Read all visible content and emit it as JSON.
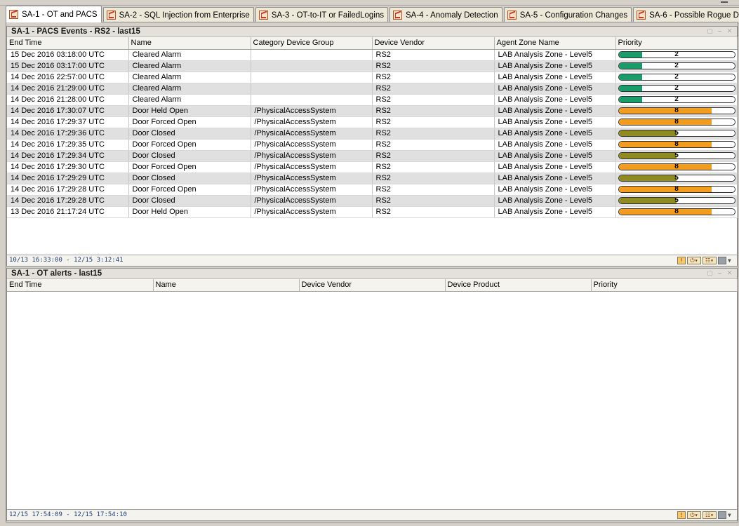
{
  "tabs": [
    {
      "label": "SA-1 - OT and PACS",
      "active": true
    },
    {
      "label": "SA-2 - SQL Injection from Enterprise",
      "active": false
    },
    {
      "label": "SA-3 - OT-to-IT or FailedLogins",
      "active": false
    },
    {
      "label": "SA-4 - Anomaly Detection",
      "active": false
    },
    {
      "label": "SA-5 - Configuration Changes",
      "active": false
    },
    {
      "label": "SA-6 - Possible Rogue Device",
      "active": false
    }
  ],
  "pacs": {
    "title": "SA-1 - PACS Events - RS2 - last15",
    "columns": [
      "End Time",
      "Name",
      "Category Device Group",
      "Device Vendor",
      "Agent Zone Name",
      "Priority"
    ],
    "rows": [
      {
        "end_time": "15 Dec 2016 03:18:00 UTC",
        "name": "Cleared Alarm",
        "category": "",
        "vendor": "RS2",
        "zone": "LAB Analysis Zone - Level5",
        "priority": 2
      },
      {
        "end_time": "15 Dec 2016 03:17:00 UTC",
        "name": "Cleared Alarm",
        "category": "",
        "vendor": "RS2",
        "zone": "LAB Analysis Zone - Level5",
        "priority": 2
      },
      {
        "end_time": "14 Dec 2016 22:57:00 UTC",
        "name": "Cleared Alarm",
        "category": "",
        "vendor": "RS2",
        "zone": "LAB Analysis Zone - Level5",
        "priority": 2
      },
      {
        "end_time": "14 Dec 2016 21:29:00 UTC",
        "name": "Cleared Alarm",
        "category": "",
        "vendor": "RS2",
        "zone": "LAB Analysis Zone - Level5",
        "priority": 2
      },
      {
        "end_time": "14 Dec 2016 21:28:00 UTC",
        "name": "Cleared Alarm",
        "category": "",
        "vendor": "RS2",
        "zone": "LAB Analysis Zone - Level5",
        "priority": 2
      },
      {
        "end_time": "14 Dec 2016 17:30:07 UTC",
        "name": "Door Held Open",
        "category": "/PhysicalAccessSystem",
        "vendor": "RS2",
        "zone": "LAB Analysis Zone - Level5",
        "priority": 8
      },
      {
        "end_time": "14 Dec 2016 17:29:37 UTC",
        "name": "Door Forced Open",
        "category": "/PhysicalAccessSystem",
        "vendor": "RS2",
        "zone": "LAB Analysis Zone - Level5",
        "priority": 8
      },
      {
        "end_time": "14 Dec 2016 17:29:36 UTC",
        "name": "Door Closed",
        "category": "/PhysicalAccessSystem",
        "vendor": "RS2",
        "zone": "LAB Analysis Zone - Level5",
        "priority": 5
      },
      {
        "end_time": "14 Dec 2016 17:29:35 UTC",
        "name": "Door Forced Open",
        "category": "/PhysicalAccessSystem",
        "vendor": "RS2",
        "zone": "LAB Analysis Zone - Level5",
        "priority": 8
      },
      {
        "end_time": "14 Dec 2016 17:29:34 UTC",
        "name": "Door Closed",
        "category": "/PhysicalAccessSystem",
        "vendor": "RS2",
        "zone": "LAB Analysis Zone - Level5",
        "priority": 5
      },
      {
        "end_time": "14 Dec 2016 17:29:30 UTC",
        "name": "Door Forced Open",
        "category": "/PhysicalAccessSystem",
        "vendor": "RS2",
        "zone": "LAB Analysis Zone - Level5",
        "priority": 8
      },
      {
        "end_time": "14 Dec 2016 17:29:29 UTC",
        "name": "Door Closed",
        "category": "/PhysicalAccessSystem",
        "vendor": "RS2",
        "zone": "LAB Analysis Zone - Level5",
        "priority": 5
      },
      {
        "end_time": "14 Dec 2016 17:29:28 UTC",
        "name": "Door Forced Open",
        "category": "/PhysicalAccessSystem",
        "vendor": "RS2",
        "zone": "LAB Analysis Zone - Level5",
        "priority": 8
      },
      {
        "end_time": "14 Dec 2016 17:29:28 UTC",
        "name": "Door Closed",
        "category": "/PhysicalAccessSystem",
        "vendor": "RS2",
        "zone": "LAB Analysis Zone - Level5",
        "priority": 5
      },
      {
        "end_time": "13 Dec 2016 21:17:24 UTC",
        "name": "Door Held Open",
        "category": "/PhysicalAccessSystem",
        "vendor": "RS2",
        "zone": "LAB Analysis Zone - Level5",
        "priority": 8
      }
    ],
    "status_range": "10/13 16:33:00 - 12/15 3:12:41"
  },
  "ot": {
    "title": "SA-1 - OT alerts - last15",
    "columns": [
      "End Time",
      "Name",
      "Device Vendor",
      "Device Product",
      "Priority"
    ],
    "rows": [],
    "status_range": "12/15 17:54:09 - 12/15 17:54:10"
  },
  "priority_scale": {
    "max": 10
  },
  "priority_colors": {
    "2": "#1a9b6a",
    "5": "#8f8a22",
    "8": "#f39c22"
  }
}
